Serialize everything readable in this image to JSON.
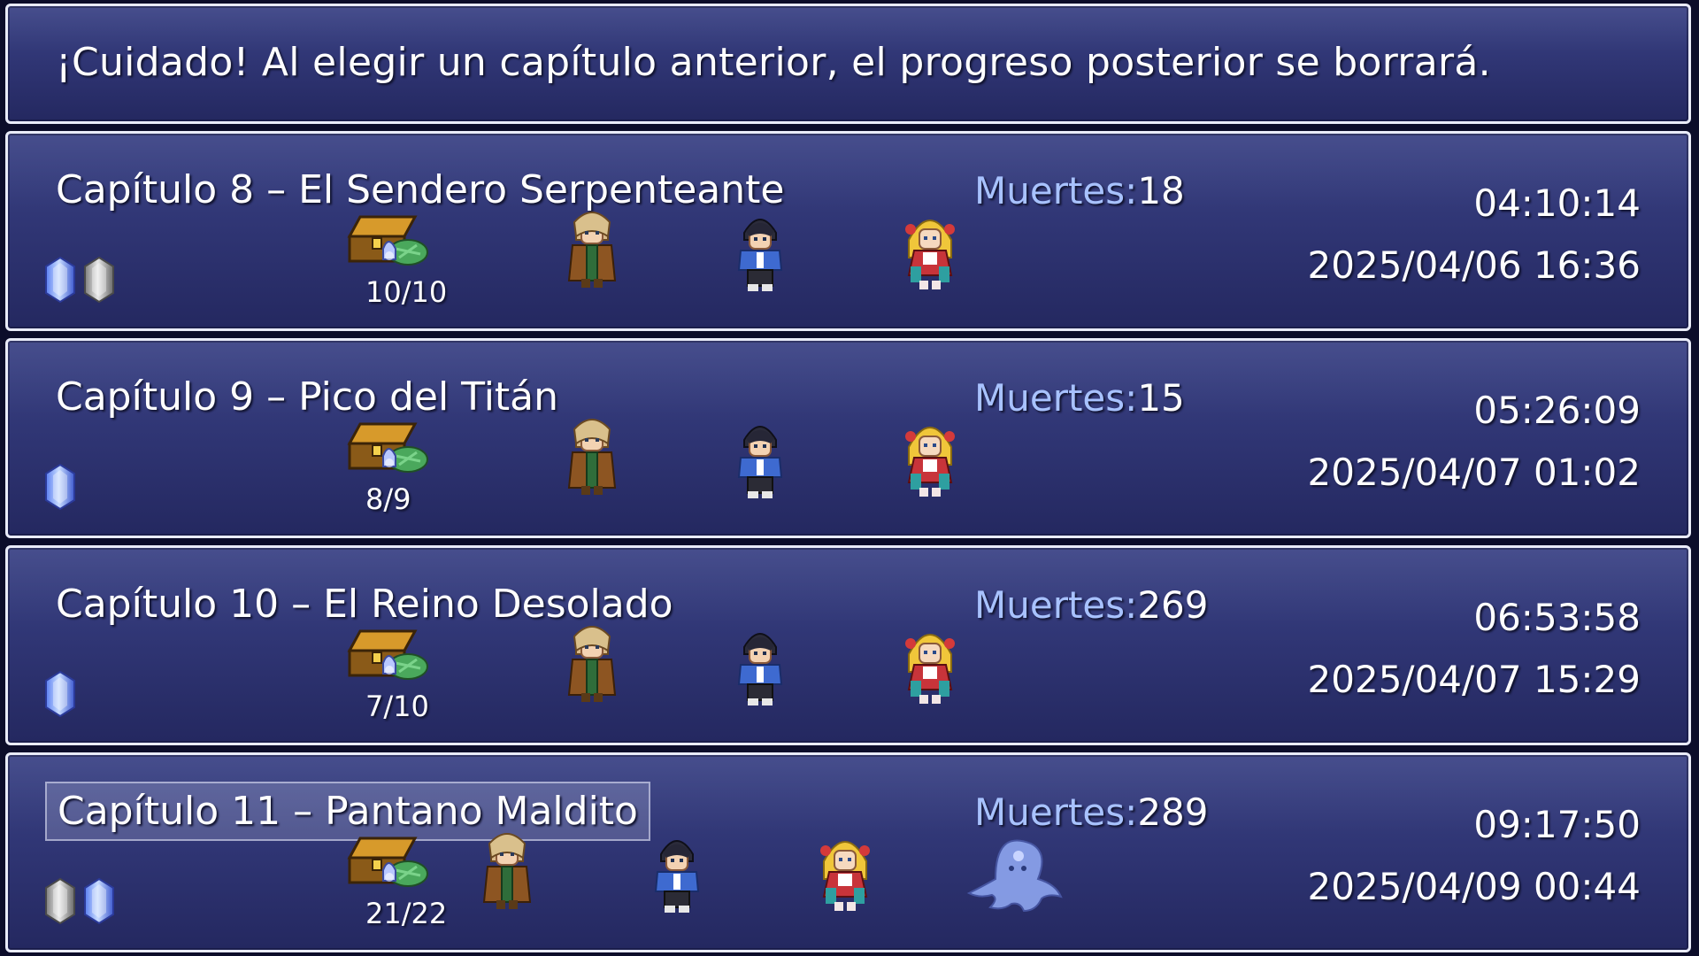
{
  "help": {
    "text": "¡Cuidado! Al elegir un capítulo anterior, el progreso posterior se borrará."
  },
  "deaths_label": "Muertes:",
  "chapters": [
    {
      "title": "Capítulo 8 – El Sendero Serpenteante",
      "deaths": "18",
      "playtime": "04:10:14",
      "datetime": "2025/04/06 16:36",
      "treasure": "10/10",
      "gems": [
        "blue",
        "gray"
      ],
      "party": [
        "brown-coat-character",
        "blue-jacket-character",
        "blonde-girl-character"
      ],
      "selected": false
    },
    {
      "title": "Capítulo 9 – Pico del Titán",
      "deaths": "15",
      "playtime": "05:26:09",
      "datetime": "2025/04/07 01:02",
      "treasure": "8/9",
      "gems": [
        "blue"
      ],
      "party": [
        "brown-coat-character",
        "blue-jacket-character",
        "blonde-girl-character"
      ],
      "selected": false
    },
    {
      "title": "Capítulo 10 – El Reino Desolado",
      "deaths": "269",
      "playtime": "06:53:58",
      "datetime": "2025/04/07 15:29",
      "treasure": "7/10",
      "gems": [
        "blue"
      ],
      "party": [
        "brown-coat-character",
        "blue-jacket-character",
        "blonde-girl-character"
      ],
      "selected": false
    },
    {
      "title": "Capítulo 11 – Pantano Maldito",
      "deaths": "289",
      "playtime": "09:17:50",
      "datetime": "2025/04/09 00:44",
      "treasure": "21/22",
      "gems": [
        "gray",
        "blue"
      ],
      "party": [
        "brown-coat-character",
        "blue-jacket-character",
        "blonde-girl-character",
        "ghost-creature"
      ],
      "selected": true
    }
  ],
  "colors": {
    "window_top": "#3b4386",
    "window_bottom": "#242860",
    "border": "#e9ebf8",
    "deaths_label": "#a8c2ff",
    "text": "#ffffff"
  }
}
